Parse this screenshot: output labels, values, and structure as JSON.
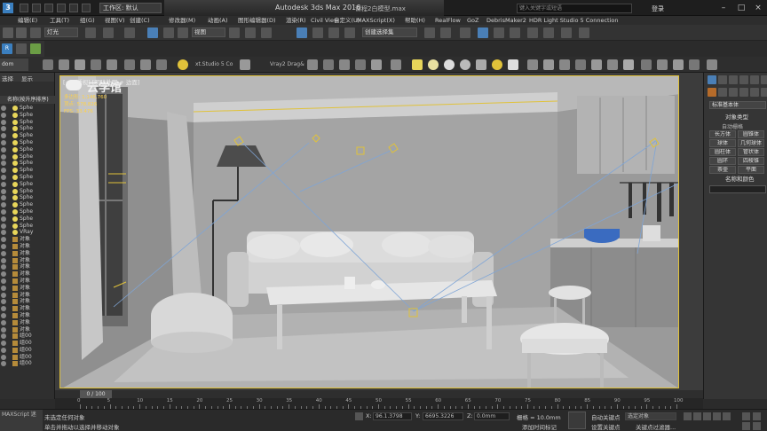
{
  "titlebar": {
    "logo": "3",
    "workspace": "工作区: 默认",
    "app_title": "Autodesk 3ds Max 2016",
    "file_title": "课程2白模型.max",
    "search_placeholder": "键入关键字或短语",
    "login": "登录"
  },
  "menubar": {
    "items": [
      "编辑(E)",
      "工具(T)",
      "组(G)",
      "视图(V)",
      "创建(C)",
      "修改器(M)",
      "动画(A)",
      "图形编辑器(D)",
      "渲染(R)",
      "Civil View",
      "自定义(U)",
      "MAXScript(X)",
      "帮助(H)",
      "RealFlow",
      "GoZ",
      "DebrisMaker2",
      "HDR Light Studio 5 Connection"
    ]
  },
  "toolbar": {
    "filter_dropdown": "灯光",
    "ref_coord": "视图",
    "named_selection": "创建选择集"
  },
  "ribbon": {
    "label": "dom Master",
    "studio_label": "xt.Studio 5 Co",
    "vray_label": "Vray2 Drag&"
  },
  "explorer": {
    "tab_select": "选择",
    "tab_display": "显示",
    "header": "名称(按升序排序)",
    "items": [
      "Sphe",
      "Sphe",
      "Sphe",
      "Sphe",
      "Sphe",
      "Sphe",
      "Sphe",
      "Sphe",
      "Sphe",
      "Sphe",
      "Sphe",
      "Sphe",
      "Sphe",
      "Sphe",
      "Sphe",
      "Sphe",
      "Sphe",
      "Sphe",
      "VRay",
      "对象",
      "对象",
      "对象",
      "对象",
      "对象",
      "对象",
      "对象",
      "对象",
      "对象",
      "对象",
      "对象",
      "对象",
      "对象",
      "对象",
      "组00",
      "组00",
      "组00",
      "组00",
      "组00"
    ]
  },
  "viewport": {
    "label": "[+] [透视] [明暗处理 + 边面]",
    "stats": [
      "多边形: 1,146,760",
      "顶点: 578,826",
      "FPS: 33.476"
    ],
    "watermark": "云学馆"
  },
  "cmdpanel": {
    "category": "标准基本体",
    "object_type_title": "对象类型",
    "autogrid": "自动栅格",
    "buttons": [
      "长方体",
      "圆锥体",
      "球体",
      "几何球体",
      "圆柱体",
      "管状体",
      "圆环",
      "四棱锥",
      "茶壶",
      "平面"
    ],
    "name_color_title": "名称和颜色"
  },
  "timeline": {
    "frame": "0 / 100",
    "ticks": [
      "0",
      "5",
      "10",
      "15",
      "20",
      "25",
      "30",
      "35",
      "40",
      "45",
      "50",
      "55",
      "60",
      "65",
      "70",
      "75",
      "80",
      "85",
      "90",
      "95",
      "100"
    ]
  },
  "status": {
    "maxscript": "MAXScript 迷",
    "prompt1": "未选定任何对象",
    "prompt2": "单击并拖动以选择并移动对象",
    "x_label": "X:",
    "x_value": "96.1.3798",
    "y_label": "Y:",
    "y_value": "6695.3226",
    "z_label": "Z:",
    "z_value": "0.0mm",
    "grid": "栅格 = 10.0mm",
    "add_time_tag": "添加时间标记",
    "auto_key": "自动关键点",
    "set_key": "设置关键点",
    "selected": "选定对象",
    "key_filters": "关键点过滤器..."
  },
  "colors": {
    "selection_border": "#e0c23a",
    "light_color": "#e8d65a",
    "accent_blue": "#3b7fbf"
  }
}
